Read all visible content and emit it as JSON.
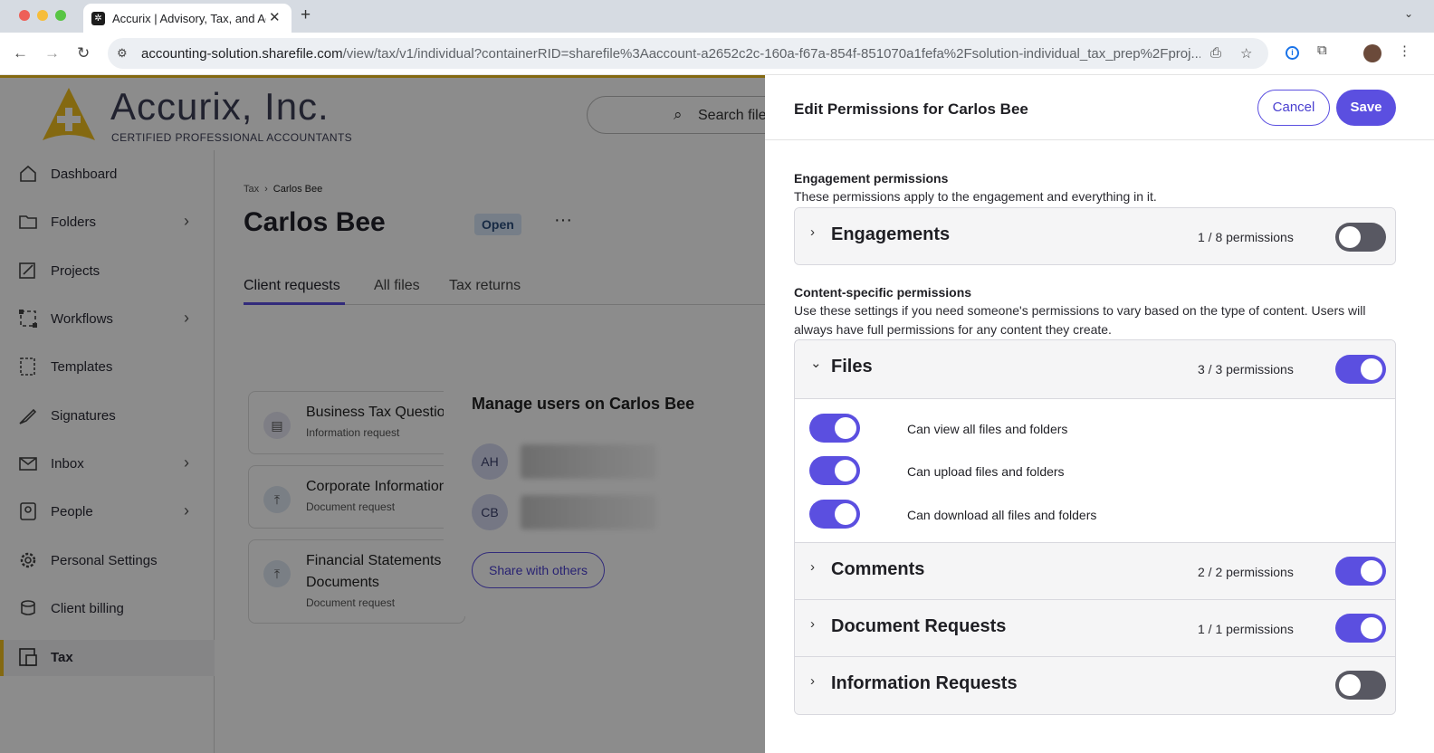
{
  "browser": {
    "tab_title": "Accurix | Advisory, Tax, and Accounting",
    "url_host": "accounting-solution.sharefile.com",
    "url_path": "/view/tax/v1/individual?containerRID=sharefile%3Aaccount-a2652c2c-160a-f67a-854f-851070a1fefa%2Fsolution-individual_tax_prep%2Fproj..."
  },
  "app": {
    "brand_name": "Accurix, Inc.",
    "brand_tagline": "CERTIFIED PROFESSIONAL ACCOUNTANTS",
    "search_placeholder": "Search file",
    "accent_color": "#5b4fe0",
    "brand_color": "#f0c020"
  },
  "sidebar": {
    "items": [
      {
        "label": "Dashboard",
        "icon": "home-icon"
      },
      {
        "label": "Folders",
        "icon": "folder-icon"
      },
      {
        "label": "Projects",
        "icon": "projects-icon"
      },
      {
        "label": "Workflows",
        "icon": "workflows-icon"
      },
      {
        "label": "Templates",
        "icon": "templates-icon"
      },
      {
        "label": "Signatures",
        "icon": "signature-icon"
      },
      {
        "label": "Inbox",
        "icon": "inbox-icon"
      },
      {
        "label": "People",
        "icon": "people-icon"
      },
      {
        "label": "Personal Settings",
        "icon": "gear-icon"
      },
      {
        "label": "Client billing",
        "icon": "billing-icon"
      },
      {
        "label": "Tax",
        "icon": "tax-icon"
      }
    ]
  },
  "page": {
    "breadcrumb_root": "Tax",
    "breadcrumb_current": "Carlos Bee",
    "title": "Carlos Bee",
    "status": "Open",
    "tabs": [
      "Client requests",
      "All files",
      "Tax returns"
    ]
  },
  "requests": [
    {
      "title": "Business Tax Questionnaire",
      "type": "Information request"
    },
    {
      "title": "Corporate Information",
      "type": "Document request"
    },
    {
      "title": "Financial Statements Documents",
      "title_line1": "Financial Statements",
      "title_line2": "Documents",
      "type": "Document request"
    }
  ],
  "manage_dialog": {
    "title": "Manage users on Carlos Bee",
    "users": [
      {
        "initials": "AH"
      },
      {
        "initials": "CB"
      }
    ],
    "share_label": "Share with others"
  },
  "panel": {
    "title": "Edit Permissions for Carlos Bee",
    "cancel_label": "Cancel",
    "save_label": "Save",
    "engagement_heading": "Engagement permissions",
    "engagement_desc": "These permissions apply to the engagement and everything in it.",
    "engagements": {
      "title": "Engagements",
      "count": "1 / 8 permissions",
      "enabled": false
    },
    "content_heading": "Content-specific permissions",
    "content_desc": "Use these settings if you need someone's permissions to vary based on the type of content. Users will always have full permissions for any content they create.",
    "files": {
      "title": "Files",
      "count": "3 / 3 permissions",
      "enabled": true,
      "items": [
        {
          "label": "Can view all files and folders",
          "enabled": true
        },
        {
          "label": "Can upload files and folders",
          "enabled": true
        },
        {
          "label": "Can download all files and folders",
          "enabled": true
        }
      ]
    },
    "comments": {
      "title": "Comments",
      "count": "2 / 2 permissions",
      "enabled": true
    },
    "document_requests": {
      "title": "Document Requests",
      "count": "1 / 1 permissions",
      "enabled": true
    },
    "information_requests": {
      "title": "Information Requests",
      "enabled": false
    }
  }
}
